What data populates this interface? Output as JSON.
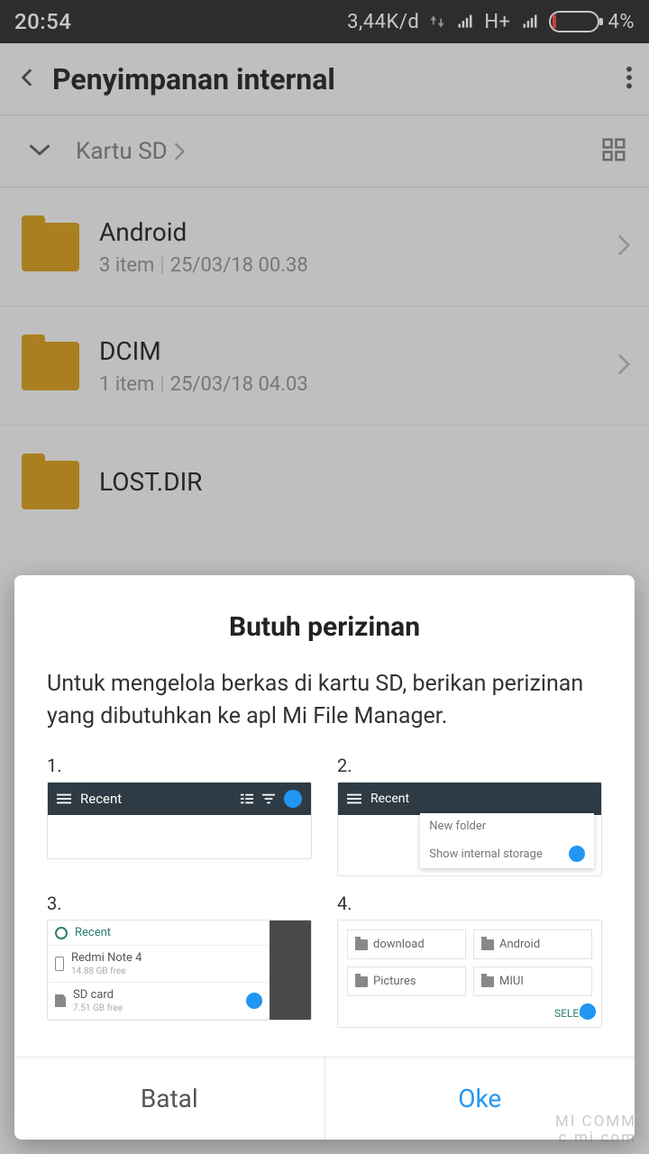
{
  "status": {
    "time": "20:54",
    "speed": "3,44K/d",
    "network": "H+",
    "battery_pct": "4%"
  },
  "header": {
    "title": "Penyimpanan internal"
  },
  "breadcrumb": {
    "path": "Kartu SD"
  },
  "folders": [
    {
      "name": "Android",
      "count": "3 item",
      "date": "25/03/18 00.38"
    },
    {
      "name": "DCIM",
      "count": "1 item",
      "date": "25/03/18 04.03"
    },
    {
      "name": "LOST.DIR",
      "count": "",
      "date": ""
    }
  ],
  "dialog": {
    "title": "Butuh perizinan",
    "message": "Untuk mengelola berkas di kartu SD, berikan perizinan yang dibutuhkan ke apl Mi File Manager.",
    "steps": {
      "s1_num": "1.",
      "s2_num": "2.",
      "s3_num": "3.",
      "s4_num": "4.",
      "recent": "Recent",
      "menu_newfolder": "New folder",
      "menu_showinternal": "Show internal storage",
      "dev_name": "Redmi Note 4",
      "dev_free": "14.88 GB free",
      "sd_name": "SD card",
      "sd_free": "7.51 GB free",
      "chip_download": "download",
      "chip_android": "Android",
      "chip_pictures": "Pictures",
      "chip_miui": "MIUI",
      "select_label": "SELECT"
    },
    "cancel": "Batal",
    "ok": "Oke"
  },
  "watermark": {
    "l1": "MI COMM",
    "l2": "c.mi.com"
  }
}
